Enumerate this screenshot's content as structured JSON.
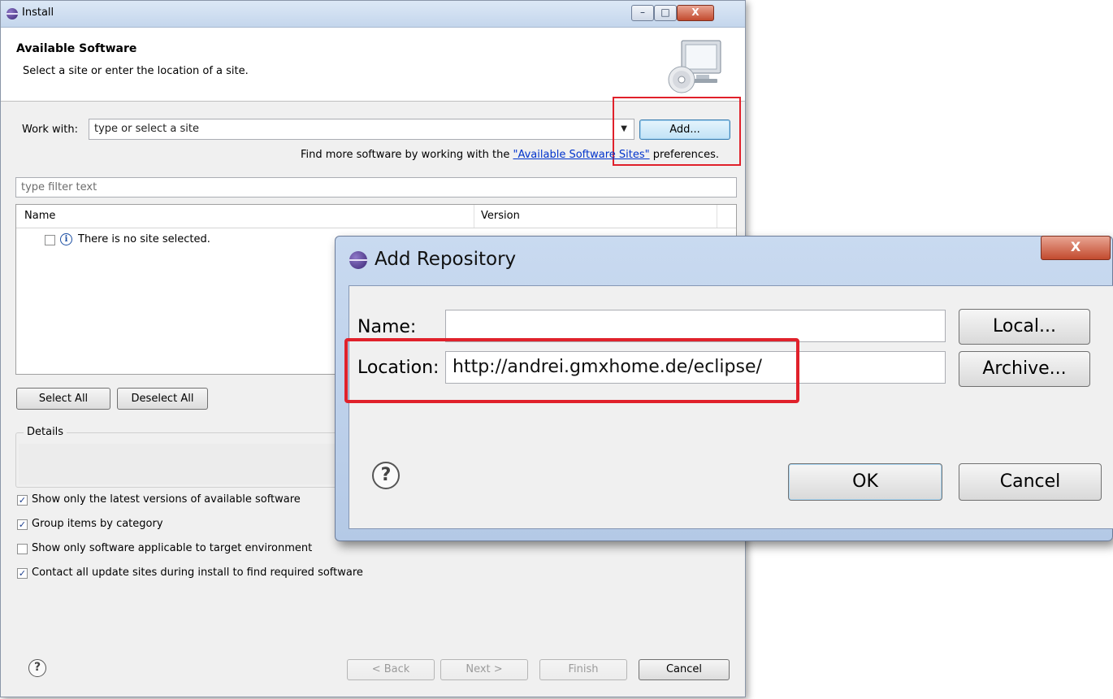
{
  "install": {
    "title": "Install",
    "header_title": "Available Software",
    "header_subtitle": "Select a site or enter the location of a site.",
    "work_with_label": "Work with:",
    "work_with_placeholder": "type or select a site",
    "add_button": "Add...",
    "find_more_prefix": "Find more software by working with the ",
    "find_more_link": "\"Available Software Sites\"",
    "find_more_suffix": " preferences.",
    "filter_placeholder": "type filter text",
    "columns": [
      "Name",
      "Version"
    ],
    "tree_item": "There is no site selected.",
    "select_all": "Select All",
    "deselect_all": "Deselect All",
    "details_label": "Details",
    "options": [
      {
        "label": "Show only the latest versions of available software",
        "checked": true
      },
      {
        "label": "Group items by category",
        "checked": true
      },
      {
        "label": "Show only software applicable to target environment",
        "checked": false
      },
      {
        "label": "Contact all update sites during install to find required software",
        "checked": true
      }
    ],
    "back_button": "< Back",
    "next_button": "Next >",
    "finish_button": "Finish",
    "cancel_button": "Cancel",
    "help_glyph": "?",
    "minimize_glyph": "–",
    "maximize_glyph": "□",
    "close_glyph": "X"
  },
  "add_repository": {
    "title": "Add Repository",
    "name_label": "Name:",
    "name_value": "",
    "location_label": "Location:",
    "location_value": "http://andrei.gmxhome.de/eclipse/",
    "local_button": "Local...",
    "archive_button": "Archive...",
    "ok_button": "OK",
    "cancel_button": "Cancel",
    "help_glyph": "?",
    "close_glyph": "X"
  },
  "highlight_color": "#e0212b"
}
